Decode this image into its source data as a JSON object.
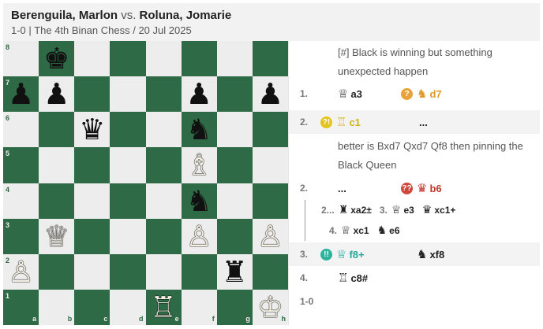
{
  "game": {
    "white_player": "Berenguila, Marlon",
    "vs": "vs.",
    "black_player": "Roluna, Jomarie",
    "result": "1-0",
    "event": "The 4th Binan Chess",
    "date": "20 Jul 2025"
  },
  "board": {
    "colors": {
      "light": "#ededed",
      "dark": "#2e6a46"
    },
    "files": [
      "a",
      "b",
      "c",
      "d",
      "e",
      "f",
      "g",
      "h"
    ],
    "ranks": [
      "8",
      "7",
      "6",
      "5",
      "4",
      "3",
      "2",
      "1"
    ],
    "pieces": [
      {
        "square": "b8",
        "glyph": "♚",
        "side": "black"
      },
      {
        "square": "a7",
        "glyph": "♟",
        "side": "black"
      },
      {
        "square": "b7",
        "glyph": "♟",
        "side": "black"
      },
      {
        "square": "f7",
        "glyph": "♟",
        "side": "black"
      },
      {
        "square": "h7",
        "glyph": "♟",
        "side": "black"
      },
      {
        "square": "c6",
        "glyph": "♛",
        "side": "black"
      },
      {
        "square": "f6",
        "glyph": "♞",
        "side": "black"
      },
      {
        "square": "f5",
        "glyph": "♗",
        "side": "white"
      },
      {
        "square": "f4",
        "glyph": "♞",
        "side": "black"
      },
      {
        "square": "b3",
        "glyph": "♕",
        "side": "white"
      },
      {
        "square": "f3",
        "glyph": "♙",
        "side": "white"
      },
      {
        "square": "h3",
        "glyph": "♙",
        "side": "white"
      },
      {
        "square": "a2",
        "glyph": "♙",
        "side": "white"
      },
      {
        "square": "g2",
        "glyph": "♜",
        "side": "black"
      },
      {
        "square": "e1",
        "glyph": "♖",
        "side": "white"
      },
      {
        "square": "h1",
        "glyph": "♔",
        "side": "white"
      }
    ]
  },
  "moves": {
    "intro_comment": "[#] Black is winning but something unexpected happen",
    "m1_num": "1.",
    "m1_white": "a3",
    "m1_white_fig": "♕",
    "m1_black_badge": "?",
    "m1_black": "d7",
    "m1_black_fig": "♞",
    "m2_num": "2.",
    "m2_white_badge": "?!",
    "m2_white_fig": "♖",
    "m2_white": "c1",
    "m2_black_placeholder": "...",
    "m2_comment": "better is Bxd7 Qxd7 Qf8 then pinning the Black Queen",
    "m2b_num": "2.",
    "m2b_white_placeholder": "...",
    "m2b_black_badge": "??",
    "m2b_black_fig": "♛",
    "m2b_black": "b6",
    "var_n1": "2...",
    "var_m1_fig": "♜",
    "var_m1": "xa2±",
    "var_n2": "3.",
    "var_m2_fig": "♕",
    "var_m2": "e3",
    "var_m3_fig": "♛",
    "var_m3": "xc1+",
    "var_n4": "4.",
    "var_m4_fig": "♕",
    "var_m4": "xc1",
    "var_m5_fig": "♞",
    "var_m5": "e6",
    "m3_num": "3.",
    "m3_white_badge": "!!",
    "m3_white_fig": "♕",
    "m3_white": "f8+",
    "m3_black_fig": "♞",
    "m3_black": "xf8",
    "m4_num": "4.",
    "m4_white_fig": "♖",
    "m4_white": "c8#",
    "result": "1-0"
  }
}
